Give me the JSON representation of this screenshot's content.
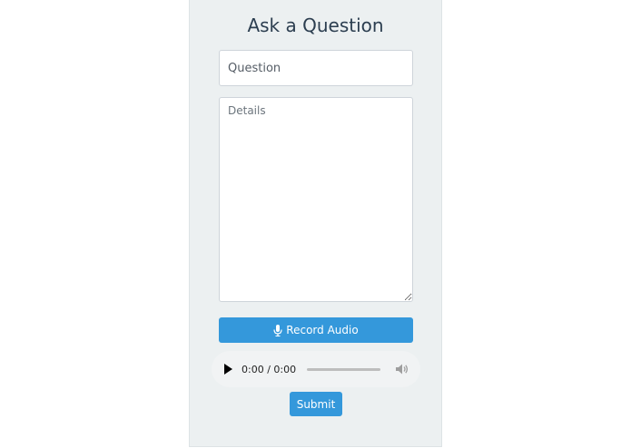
{
  "form": {
    "title": "Ask a Question",
    "question_placeholder": "Question",
    "question_value": "",
    "details_placeholder": "Details",
    "details_value": "",
    "record_label": "Record Audio",
    "submit_label": "Submit"
  },
  "audio": {
    "time_display": "0:00 / 0:00",
    "progress": 0
  },
  "icons": {
    "record": "microphone-icon",
    "play": "play-icon",
    "volume": "volume-icon"
  },
  "colors": {
    "accent": "#3498db",
    "panel_bg": "#ecf0f1",
    "title": "#2c3e50"
  }
}
